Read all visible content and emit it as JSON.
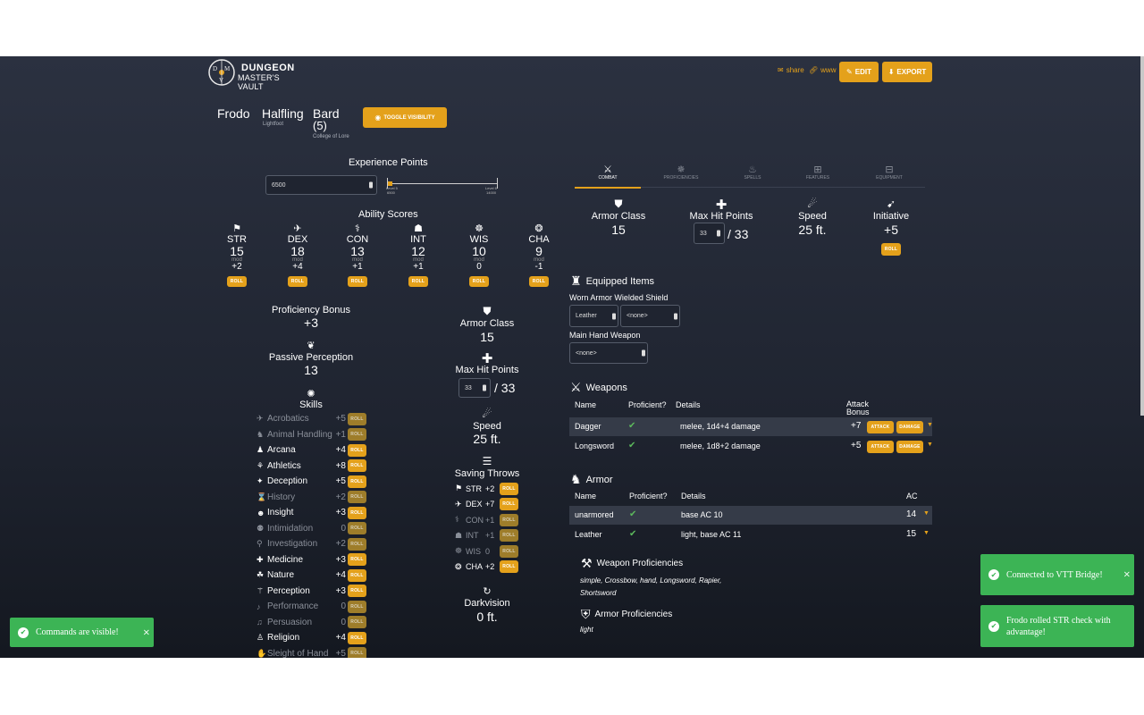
{
  "brand": {
    "line1": "DUNGEON",
    "line2": "MASTER'S VAULT",
    "logo_letters": [
      "D",
      "M",
      "V"
    ]
  },
  "header": {
    "share": "share",
    "www": "www",
    "edit": "EDIT",
    "export": "EXPORT"
  },
  "character": {
    "name": "Frodo",
    "race": "Halfling",
    "subrace": "Lightfoot",
    "class": "Bard",
    "level": "(5)",
    "subclass": "College of Lore",
    "toggle": "TOGGLE VISIBILITY"
  },
  "xp": {
    "label": "Experience Points",
    "value": "6500",
    "from_label": "Level 5",
    "from_xp": "6500",
    "to_label": "Level 6",
    "to_xp": "14000",
    "progress": 0.02
  },
  "abilities": {
    "title": "Ability Scores",
    "mod_label": "mod",
    "roll": "ROLL",
    "items": [
      {
        "name": "STR",
        "score": "15",
        "mod": "+2",
        "icon": "str-icon",
        "glyph": "⚑"
      },
      {
        "name": "DEX",
        "score": "18",
        "mod": "+4",
        "icon": "dex-icon",
        "glyph": "✈"
      },
      {
        "name": "CON",
        "score": "13",
        "mod": "+1",
        "icon": "con-icon",
        "glyph": "⚕"
      },
      {
        "name": "INT",
        "score": "12",
        "mod": "+1",
        "icon": "int-icon",
        "glyph": "☗"
      },
      {
        "name": "WIS",
        "score": "10",
        "mod": "0",
        "icon": "wis-icon",
        "glyph": "☸"
      },
      {
        "name": "CHA",
        "score": "9",
        "mod": "-1",
        "icon": "cha-icon",
        "glyph": "❂"
      }
    ]
  },
  "prof_bonus": {
    "label": "Proficiency Bonus",
    "value": "+3"
  },
  "passive": {
    "label": "Passive Perception",
    "value": "13"
  },
  "skills": {
    "title": "Skills",
    "roll": "ROLL",
    "items": [
      {
        "name": "Acrobatics",
        "value": "+5",
        "prof": false
      },
      {
        "name": "Animal Handling",
        "value": "+1",
        "prof": false
      },
      {
        "name": "Arcana",
        "value": "+4",
        "prof": true
      },
      {
        "name": "Athletics",
        "value": "+8",
        "prof": true
      },
      {
        "name": "Deception",
        "value": "+5",
        "prof": true
      },
      {
        "name": "History",
        "value": "+2",
        "prof": false
      },
      {
        "name": "Insight",
        "value": "+3",
        "prof": true
      },
      {
        "name": "Intimidation",
        "value": "0",
        "prof": false
      },
      {
        "name": "Investigation",
        "value": "+2",
        "prof": false
      },
      {
        "name": "Medicine",
        "value": "+3",
        "prof": true
      },
      {
        "name": "Nature",
        "value": "+4",
        "prof": true
      },
      {
        "name": "Perception",
        "value": "+3",
        "prof": true
      },
      {
        "name": "Performance",
        "value": "0",
        "prof": false
      },
      {
        "name": "Persuasion",
        "value": "0",
        "prof": false
      },
      {
        "name": "Religion",
        "value": "+4",
        "prof": true
      },
      {
        "name": "Sleight of Hand",
        "value": "+5",
        "prof": false
      }
    ]
  },
  "mid": {
    "ac_label": "Armor Class",
    "ac_value": "15",
    "hp_label": "Max Hit Points",
    "hp_current": "33",
    "hp_max": "/ 33",
    "speed_label": "Speed",
    "speed_value": "25 ft.",
    "saves_title": "Saving Throws",
    "saves": [
      {
        "name": "STR",
        "value": "+2",
        "prof": true
      },
      {
        "name": "DEX",
        "value": "+7",
        "prof": true
      },
      {
        "name": "CON",
        "value": "+1",
        "prof": false
      },
      {
        "name": "INT",
        "value": "+1",
        "prof": false
      },
      {
        "name": "WIS",
        "value": "0",
        "prof": false
      },
      {
        "name": "CHA",
        "value": "+2",
        "prof": true
      }
    ],
    "dark_label": "Darkvision",
    "dark_value": "0 ft."
  },
  "tabs": [
    {
      "label": "COMBAT",
      "active": true
    },
    {
      "label": "PROFICIENCIES",
      "active": false
    },
    {
      "label": "SPELLS",
      "active": false
    },
    {
      "label": "FEATURES",
      "active": false
    },
    {
      "label": "EQUIPMENT",
      "active": false
    }
  ],
  "combat": {
    "ac_label": "Armor Class",
    "ac_value": "15",
    "hp_label": "Max Hit Points",
    "hp_current": "33",
    "hp_max": "/ 33",
    "speed_label": "Speed",
    "speed_value": "25 ft.",
    "init_label": "Initiative",
    "init_value": "+5",
    "roll": "ROLL"
  },
  "equipped": {
    "title": "Equipped Items",
    "armor_shield_label": "Worn Armor Wielded Shield",
    "armor_value": "Leather",
    "shield_value": "<none>",
    "main_hand_label": "Main Hand Weapon",
    "main_hand_value": "<none>"
  },
  "weapons": {
    "title": "Weapons",
    "headers": {
      "name": "Name",
      "prof": "Proficient?",
      "details": "Details",
      "attack": "Attack Bonus"
    },
    "attack_btn": "ATTACK",
    "damage_btn": "DAMAGE",
    "rows": [
      {
        "name": "Dagger",
        "details": "melee, 1d4+4 damage",
        "bonus": "+7"
      },
      {
        "name": "Longsword",
        "details": "melee, 1d8+2 damage",
        "bonus": "+5"
      }
    ]
  },
  "armor": {
    "title": "Armor",
    "headers": {
      "name": "Name",
      "prof": "Proficient?",
      "details": "Details",
      "ac": "AC"
    },
    "rows": [
      {
        "name": "unarmored",
        "details": "base AC 10",
        "ac": "14"
      },
      {
        "name": "Leather",
        "details": "light, base AC 11",
        "ac": "15"
      }
    ]
  },
  "weapon_prof": {
    "title": "Weapon Proficiencies",
    "text": "simple, Crossbow, hand, Longsword, Rapier, Shortsword"
  },
  "armor_prof": {
    "title": "Armor Proficiencies",
    "text": "light"
  },
  "toasts": {
    "left": "Commands are visible!",
    "vtt": "Connected to VTT Bridge!",
    "roll": "Frodo rolled STR check with advantage!",
    "close": "×"
  },
  "colors": {
    "accent": "#e4a11b",
    "success": "#3cb455",
    "bg": "#1f2430"
  }
}
